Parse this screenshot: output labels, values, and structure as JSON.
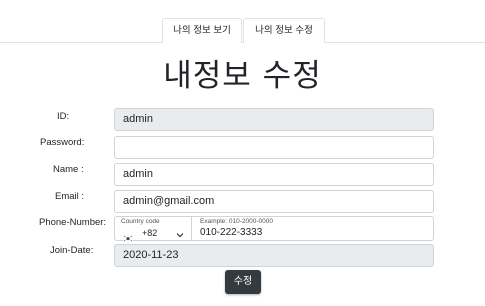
{
  "tabs": {
    "view_label": "나의 정보 보기",
    "edit_label": "나의 정보 수정"
  },
  "title": "내정보 수정",
  "form": {
    "id_label": "ID:",
    "id_value": "admin",
    "password_label": "Password:",
    "password_value": "",
    "name_label": "Name :",
    "name_value": "admin",
    "email_label": "Email :",
    "email_value": "admin@gmail.com",
    "phone_label": "Phone-Number:",
    "country_code_label": "Country code",
    "country_code_value": "+82",
    "country_flag": "south-korea-flag-icon",
    "phone_hint": "Example: 010-2000-0000",
    "phone_value": "010-222-3333",
    "join_label": "Join-Date:",
    "join_value": "2020-11-23",
    "submit_label": "수정"
  },
  "colors": {
    "readonly_bg": "#e9ecef",
    "button_bg": "#343a40",
    "border": "#ced4da"
  }
}
